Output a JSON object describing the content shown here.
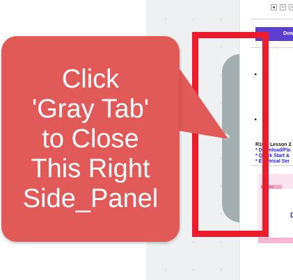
{
  "callout": {
    "text": "Click\n'Gray Tab'\nto Close\nThis Right\nSide_Panel",
    "color": "#e25a58"
  },
  "gray_tab": {
    "icon": "chevron-right-icon",
    "glyph": "›",
    "color": "#a3aeb0"
  },
  "highlight": {
    "color": "#ee1c2a"
  },
  "side_panel": {
    "download_label": "Download",
    "bullet_1": "·",
    "bullet_2": "·",
    "lesson": {
      "title": "R100: Lesson 2",
      "links": [
        "* Download/Fla",
        "* Quick Start &",
        "* Electrical Ser"
      ]
    },
    "pink_card_label": "Download",
    "pink_card_letter": "D",
    "accent_color": "#5b3fd0"
  }
}
